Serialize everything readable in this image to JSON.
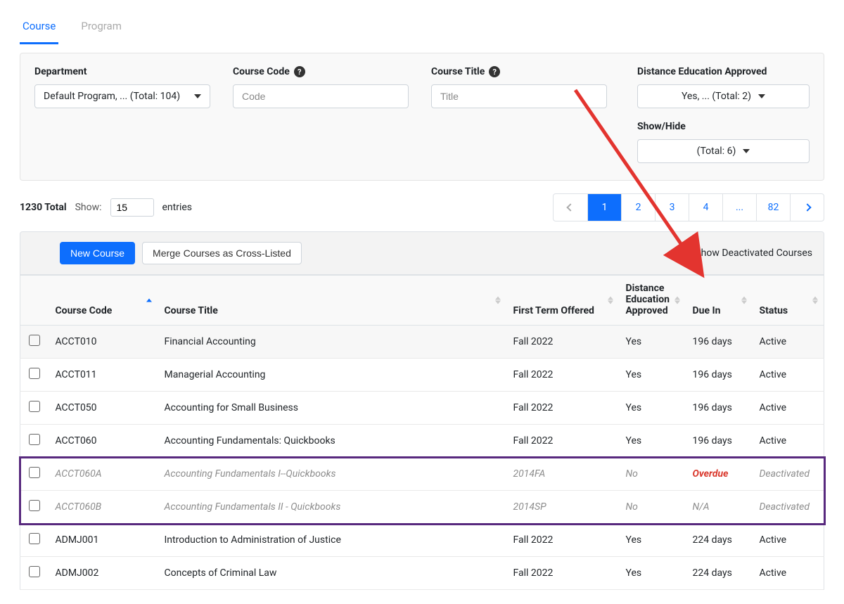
{
  "tabs": {
    "course": "Course",
    "program": "Program"
  },
  "filters": {
    "department": {
      "label": "Department",
      "value": "Default Program, ... (Total: 104)"
    },
    "course_code": {
      "label": "Course Code",
      "placeholder": "Code"
    },
    "course_title": {
      "label": "Course Title",
      "placeholder": "Title"
    },
    "distance": {
      "label": "Distance Education Approved",
      "value": "Yes, ... (Total: 2)"
    },
    "showhide": {
      "label": "Show/Hide",
      "value": "(Total: 6)"
    }
  },
  "midbar": {
    "total": "1230 Total",
    "show": "Show:",
    "entries_value": "15",
    "entries_suffix": "entries"
  },
  "pager": {
    "p1": "1",
    "p2": "2",
    "p3": "3",
    "p4": "4",
    "dots": "...",
    "last": "82"
  },
  "toolbar": {
    "new_course": "New Course",
    "merge": "Merge Courses as Cross-Listed",
    "show_deactivated": "Show Deactivated Courses"
  },
  "columns": {
    "code": "Course Code",
    "title": "Course Title",
    "term": "First Term Offered",
    "dist1": "Distance",
    "dist2": "Education",
    "dist3": "Approved",
    "due": "Due In",
    "status": "Status"
  },
  "rows": [
    {
      "code": "ACCT010",
      "title": "Financial Accounting",
      "term": "Fall 2022",
      "dist": "Yes",
      "due": "196 days",
      "status": "Active",
      "deact": false,
      "overdue": false
    },
    {
      "code": "ACCT011",
      "title": "Managerial Accounting",
      "term": "Fall 2022",
      "dist": "Yes",
      "due": "196 days",
      "status": "Active",
      "deact": false,
      "overdue": false
    },
    {
      "code": "ACCT050",
      "title": "Accounting for Small Business",
      "term": "Fall 2022",
      "dist": "Yes",
      "due": "196 days",
      "status": "Active",
      "deact": false,
      "overdue": false
    },
    {
      "code": "ACCT060",
      "title": "Accounting Fundamentals: Quickbooks",
      "term": "Fall 2022",
      "dist": "Yes",
      "due": "196 days",
      "status": "Active",
      "deact": false,
      "overdue": false
    },
    {
      "code": "ACCT060A",
      "title": "Accounting Fundamentals I--Quickbooks",
      "term": "2014FA",
      "dist": "No",
      "due": "Overdue",
      "status": "Deactivated",
      "deact": true,
      "overdue": true
    },
    {
      "code": "ACCT060B",
      "title": "Accounting Fundamentals II - Quickbooks",
      "term": "2014SP",
      "dist": "No",
      "due": "N/A",
      "status": "Deactivated",
      "deact": true,
      "overdue": false
    },
    {
      "code": "ADMJ001",
      "title": "Introduction to Administration of Justice",
      "term": "Fall 2022",
      "dist": "Yes",
      "due": "224 days",
      "status": "Active",
      "deact": false,
      "overdue": false
    },
    {
      "code": "ADMJ002",
      "title": "Concepts of Criminal Law",
      "term": "Fall 2022",
      "dist": "Yes",
      "due": "224 days",
      "status": "Active",
      "deact": false,
      "overdue": false
    }
  ]
}
